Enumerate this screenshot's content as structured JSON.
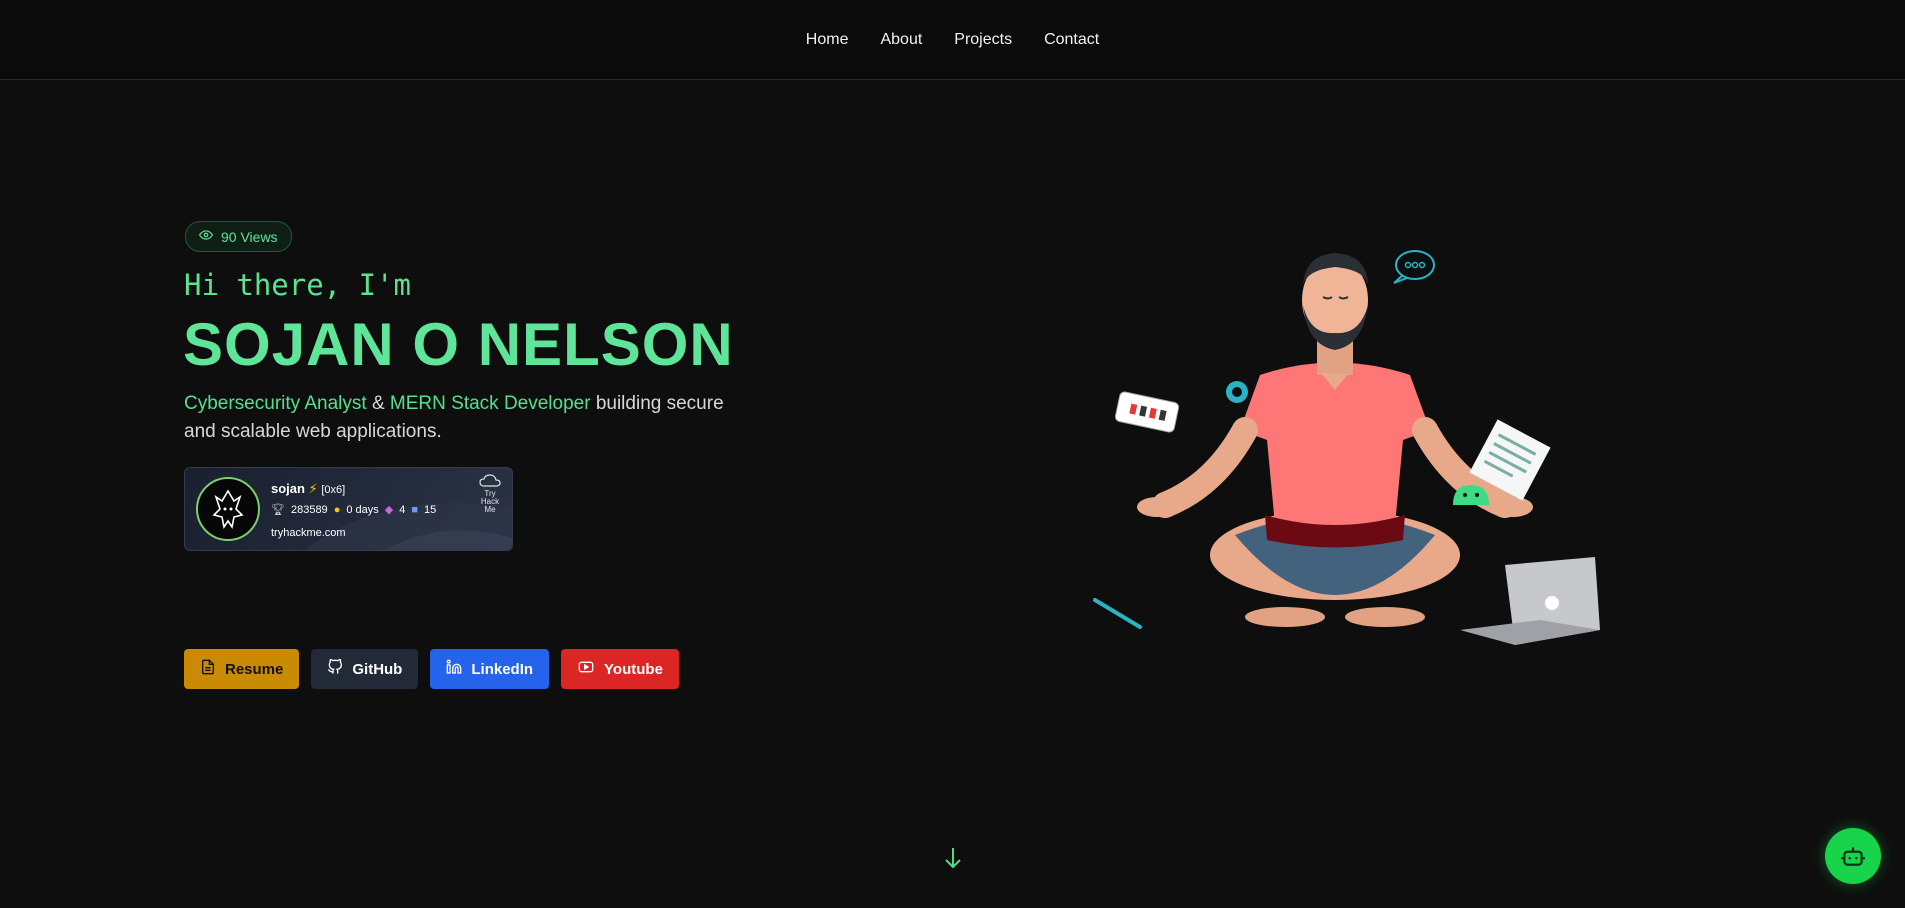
{
  "nav": {
    "items": [
      "Home",
      "About",
      "Projects",
      "Contact"
    ]
  },
  "hero": {
    "views_label": "90 Views",
    "greeting": "Hi there, I'm",
    "name": "SOJAN O NELSON",
    "role1": "Cybersecurity Analyst",
    "amp": " & ",
    "role2": "MERN Stack Developer",
    "tagline_rest": " building secure and scalable web applications."
  },
  "tryhackme": {
    "username": "sojan",
    "rank": "[0x6]",
    "points": "283589",
    "streak": "0 days",
    "badges": "4",
    "rooms": "15",
    "site": "tryhackme.com",
    "logo_text": "Try Hack Me"
  },
  "buttons": {
    "resume": "Resume",
    "github": "GitHub",
    "linkedin": "LinkedIn",
    "youtube": "Youtube"
  },
  "colors": {
    "accent": "#5ee59a",
    "bg": "#0e0e0e",
    "resume": "#ca8a04",
    "github": "#232a37",
    "linkedin": "#2563eb",
    "youtube": "#dc2626",
    "chatbot": "#17d44a"
  },
  "icons": [
    "eye-icon",
    "trophy-icon",
    "fire-icon",
    "badge-icon",
    "room-icon",
    "file-icon",
    "github-icon",
    "linkedin-icon",
    "youtube-icon",
    "arrow-down-icon",
    "robot-icon"
  ]
}
